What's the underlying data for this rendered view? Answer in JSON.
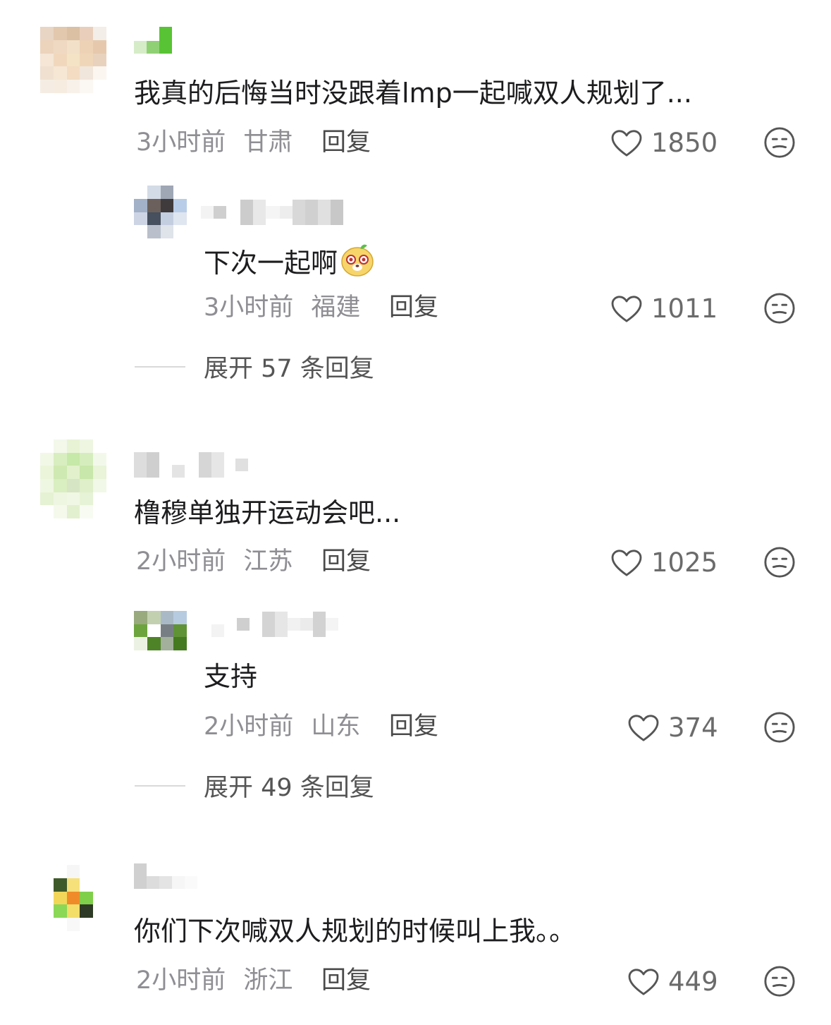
{
  "comments": [
    {
      "text": "我真的后悔当时没跟着lmp一起喊双人规划了...",
      "time": "3小时前",
      "location": "甘肃",
      "reply_label": "回复",
      "likes": "1850",
      "sub_reply": {
        "text": "下次一起啊",
        "emoji": "cute-face-emoji",
        "time": "3小时前",
        "location": "福建",
        "reply_label": "回复",
        "likes": "1011"
      },
      "expand_label": "展开 57 条回复"
    },
    {
      "text": "橹穆单独开运动会吧...",
      "time": "2小时前",
      "location": "江苏",
      "reply_label": "回复",
      "likes": "1025",
      "sub_reply": {
        "text": "支持",
        "time": "2小时前",
        "location": "山东",
        "reply_label": "回复",
        "likes": "374"
      },
      "expand_label": "展开 49 条回复"
    },
    {
      "text": "你们下次喊双人规划的时候叫上我。。",
      "time": "2小时前",
      "location": "浙江",
      "reply_label": "回复",
      "likes": "449"
    }
  ],
  "icons": {
    "like": "heart-outline-icon",
    "dislike": "neutral-face-icon"
  },
  "colors": {
    "text": "#1d1d1f",
    "meta": "#8e8e93",
    "icon": "#555555"
  }
}
